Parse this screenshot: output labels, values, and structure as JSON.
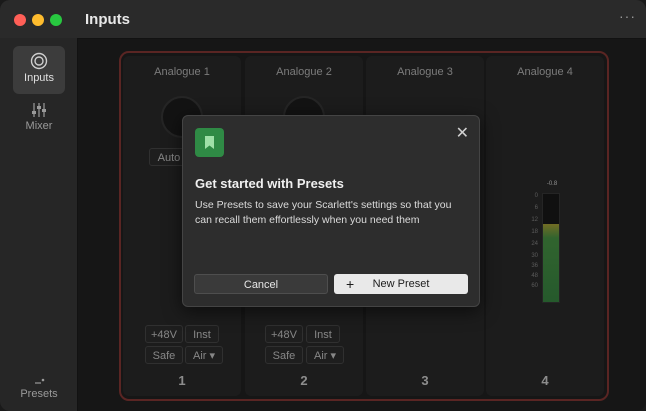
{
  "window": {
    "title": "Inputs",
    "more_label": "···"
  },
  "sidebar": {
    "items": [
      {
        "label": "Inputs",
        "icon": "inputs-icon",
        "active": true
      },
      {
        "label": "Mixer",
        "icon": "mixer-icon",
        "active": false
      }
    ],
    "presets_label": "Presets"
  },
  "channels": [
    {
      "name": "Analogue 1",
      "number": "1",
      "auto": "Auto",
      "phantom": "+48V",
      "inst": "Inst",
      "safe": "Safe",
      "air": "Air ▾"
    },
    {
      "name": "Analogue 2",
      "number": "2",
      "phantom": "+48V",
      "inst": "Inst",
      "safe": "Safe",
      "air": "Air ▾"
    },
    {
      "name": "Analogue 3",
      "number": "3"
    },
    {
      "name": "Analogue 4",
      "number": "4",
      "peak": "-0.8",
      "scale": [
        "0",
        "6",
        "12",
        "18",
        "24",
        "30",
        "36",
        "48",
        "60"
      ]
    }
  ],
  "dialog": {
    "title": "Get started with Presets",
    "body": "Use Presets to save your Scarlett's settings so that you can recall them effortlessly when you need them",
    "close_label": "✕",
    "cancel_label": "Cancel",
    "new_preset_label": "New Preset",
    "plus": "+"
  },
  "colors": {
    "accent_green": "#2f8a45",
    "device_border": "#8a3a36"
  }
}
